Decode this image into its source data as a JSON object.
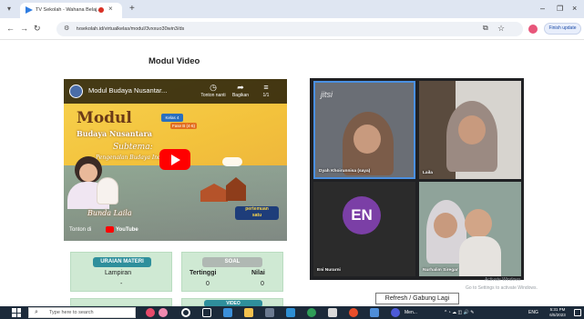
{
  "browser": {
    "tab_title": "TV Sekolah - Wahana Belaj...",
    "tab_close": "×",
    "new_tab": "+",
    "url": "tvsekolah.id/virtualkelas/modul/3vxxuo30win3/ds",
    "finish_update": "Finish update",
    "window_min": "–",
    "window_max": "❐",
    "window_close": "×"
  },
  "page": {
    "title": "Modul Video"
  },
  "video": {
    "channel_title": "Modul Budaya Nusantar...",
    "watch_later": "Tonton nanti",
    "share": "Bagikan",
    "playlist_count": "1/1",
    "module_word": "Modul",
    "module_subtitle": "Budaya Nusantara",
    "kelas": "Kelas 4",
    "fase": "Fase B (4-6)",
    "subtema": "Subtema:",
    "subtema_text": "Pengenalan Budaya Indonesia",
    "presenter": "Bunda Laila",
    "pertemuan_line1": "pertemuan",
    "pertemuan_line2": "satu",
    "watch_on": "Tonton di",
    "youtube": "YouTube"
  },
  "cards": {
    "uraian_badge": "URAIAN MATERI",
    "lampiran_label": "Lampiran",
    "lampiran_value": "-",
    "soal_badge": "SOAL",
    "tertinggi_label": "Tertinggi",
    "tertinggi_value": "0",
    "nilai_label": "Nilai",
    "nilai_value": "0",
    "bottom_badge": "VIDEO"
  },
  "meeting": {
    "logo": "jitsi",
    "participants": [
      {
        "name": "Dyah Khoirunnisa (saya)"
      },
      {
        "name": "Laila"
      },
      {
        "name": "Eni Nurarni",
        "initials": "EN"
      },
      {
        "name": "Nurhalim Siregar"
      }
    ],
    "rejoin_tooltip": "Refresh / Gabung Lagi"
  },
  "watermark": {
    "line1": "Activate Windows",
    "line2": "Go to Settings to activate Windows."
  },
  "taskbar": {
    "search_placeholder": "Type here to search",
    "tray_app": "Men...",
    "language": "ENG",
    "time": "5:31 PM",
    "date": "6/5/2023"
  },
  "colors": {
    "card_bg": "#cfe9d3",
    "uraian_badge": "#2f8f9c",
    "soal_badge": "#b0b8b3",
    "meet_bg": "#202124",
    "en_avatar": "#7b3fa6",
    "youtube_red": "#ff0000"
  }
}
